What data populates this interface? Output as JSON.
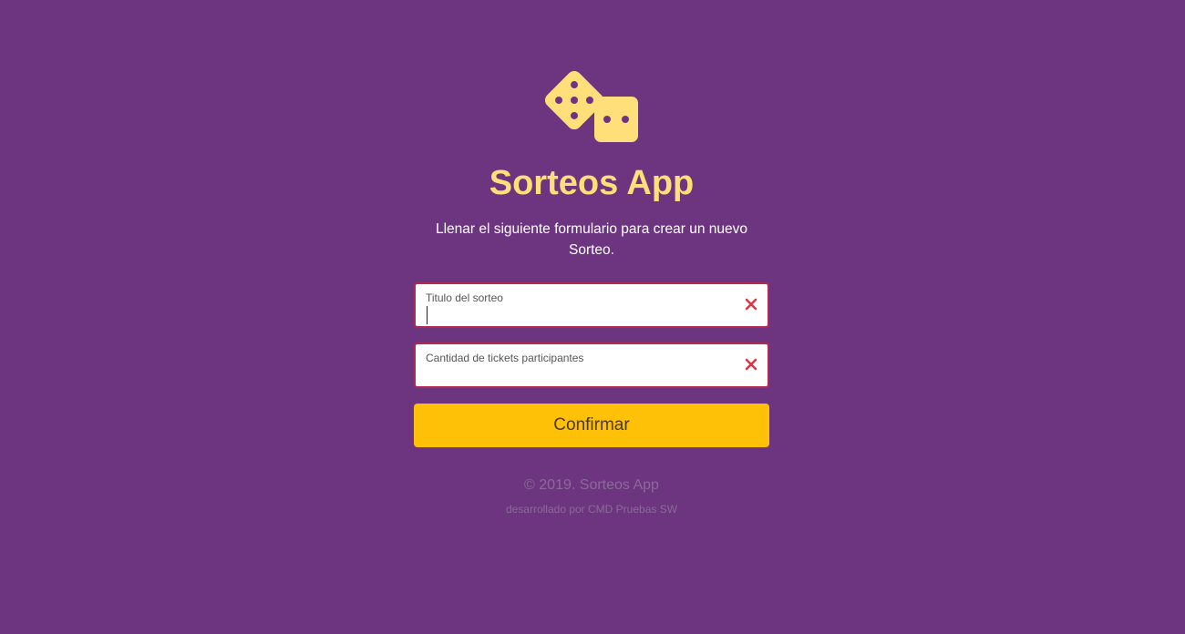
{
  "app": {
    "title": "Sorteos App",
    "subtitle": "Llenar el siguiente formulario para crear un nuevo Sorteo."
  },
  "form": {
    "fields": [
      {
        "label": "Titulo del sorteo",
        "value": "",
        "state": "invalid"
      },
      {
        "label": "Cantidad de tickets participantes",
        "value": "",
        "state": "invalid"
      }
    ],
    "confirm_label": "Confirmar"
  },
  "footer": {
    "copyright": "© 2019. Sorteos App",
    "developer": "desarrollado por CMD Pruebas SW"
  },
  "icons": {
    "logo": "dice-icon",
    "clear": "close-icon"
  },
  "colors": {
    "background": "#6d3580",
    "accent": "#ffdf7a",
    "button": "#ffc107",
    "error": "#dc3545"
  }
}
